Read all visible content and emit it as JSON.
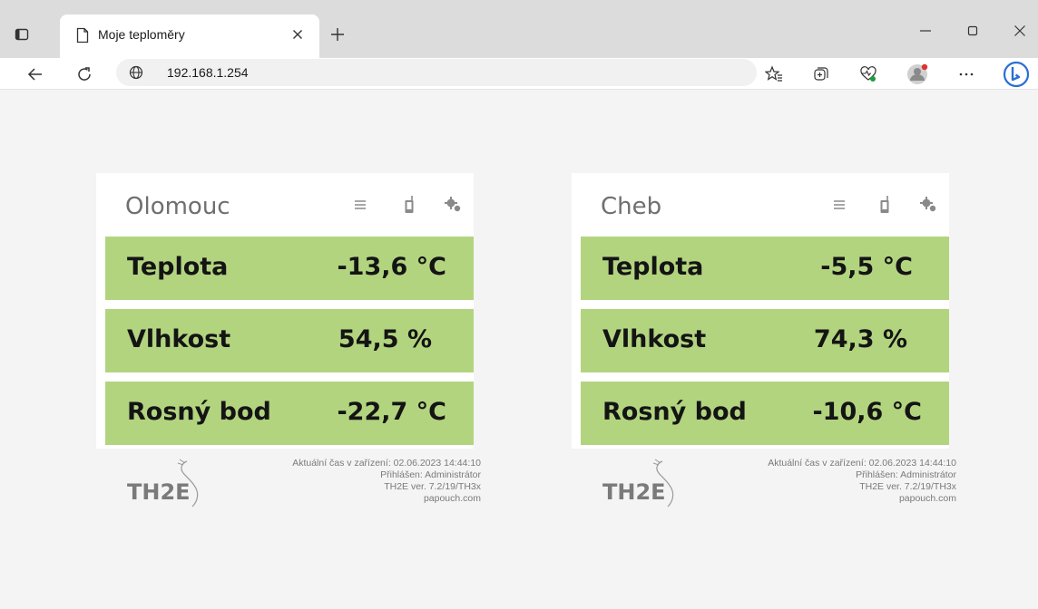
{
  "browser": {
    "tab_title": "Moje teploměry",
    "url": "192.168.1.254"
  },
  "cards": [
    {
      "title": "Olomouc",
      "rows": [
        {
          "label": "Teplota",
          "value": "-13,6 °C"
        },
        {
          "label": "Vlhkost",
          "value": "54,5 %"
        },
        {
          "label": "Rosný bod",
          "value": "-22,7 °C"
        }
      ],
      "footer": {
        "time": "Aktuální čas v zařízení: 02.06.2023 14:44:10",
        "user": "Přihlášen: Administrátor",
        "version": "TH2E ver. 7.2/19/TH3x",
        "site": "papouch.com",
        "logo_text": "TH2E"
      }
    },
    {
      "title": "Cheb",
      "rows": [
        {
          "label": "Teplota",
          "value": "-5,5 °C"
        },
        {
          "label": "Vlhkost",
          "value": "74,3 %"
        },
        {
          "label": "Rosný bod",
          "value": "-10,6 °C"
        }
      ],
      "footer": {
        "time": "Aktuální čas v zařízení: 02.06.2023 14:44:10",
        "user": "Přihlášen: Administrátor",
        "version": "TH2E ver. 7.2/19/TH3x",
        "site": "papouch.com",
        "logo_text": "TH2E"
      }
    }
  ],
  "colors": {
    "row_bg": "#b2d47f",
    "card_bg": "#ffffff",
    "page_bg": "#f4f4f4",
    "title_text": "#6f6f6f"
  }
}
